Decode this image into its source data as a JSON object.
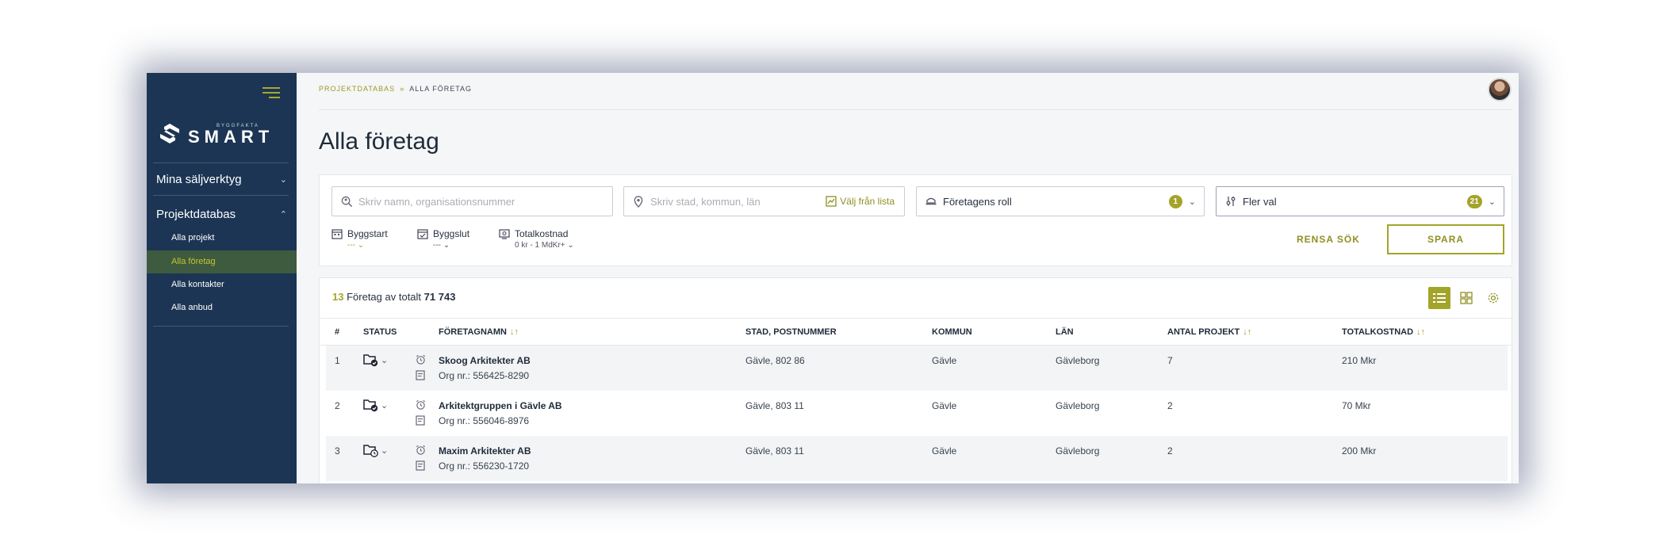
{
  "sidebar": {
    "logo_small": "BYGGFAKTA",
    "logo_big": "SMART",
    "sections": [
      {
        "label": "Mina säljverktyg",
        "expanded": false
      },
      {
        "label": "Projektdatabas",
        "expanded": true
      }
    ],
    "items": [
      {
        "label": "Alla projekt",
        "active": false
      },
      {
        "label": "Alla företag",
        "active": true
      },
      {
        "label": "Alla kontakter",
        "active": false
      },
      {
        "label": "Alla anbud",
        "active": false
      }
    ]
  },
  "breadcrumb": {
    "parent": "PROJEKTDATABAS",
    "separator": "»",
    "current": "ALLA FÖRETAG"
  },
  "page_title": "Alla företag",
  "filters": {
    "search_placeholder": "Skriv namn, organisationsnummer",
    "location_placeholder": "Skriv stad, kommun, län",
    "location_list_label": "Välj från lista",
    "role_label": "Företagens roll",
    "role_count": "1",
    "more_label": "Fler val",
    "more_count": "21",
    "byggstart_label": "Byggstart",
    "byggstart_value": "---",
    "byggslut_label": "Byggslut",
    "byggslut_value": "---",
    "totalkostnad_label": "Totalkostnad",
    "totalkostnad_value": "0 kr - 1 MdKr+",
    "clear_label": "RENSA SÖK",
    "save_label": "SPARA"
  },
  "results": {
    "count": "13",
    "count_text": "Företag av totalt",
    "total": "71 743"
  },
  "table": {
    "headers": {
      "num": "#",
      "status": "STATUS",
      "name": "FÖRETAGNAMN",
      "city": "STAD, POSTNUMMER",
      "kommun": "KOMMUN",
      "lan": "LÄN",
      "projects": "ANTAL PROJEKT",
      "cost": "TOTALKOSTNAD"
    },
    "rows": [
      {
        "num": "1",
        "name": "Skoog Arkitekter AB",
        "org": "Org nr.: 556425-8290",
        "city": "Gävle, 802 86",
        "kommun": "Gävle",
        "lan": "Gävleborg",
        "projects": "7",
        "cost": "210 Mkr"
      },
      {
        "num": "2",
        "name": "Arkitektgruppen i Gävle AB",
        "org": "Org nr.: 556046-8976",
        "city": "Gävle, 803 11",
        "kommun": "Gävle",
        "lan": "Gävleborg",
        "projects": "2",
        "cost": "70 Mkr"
      },
      {
        "num": "3",
        "name": "Maxim Arkitekter AB",
        "org": "Org nr.: 556230-1720",
        "city": "Gävle, 803 11",
        "kommun": "Gävle",
        "lan": "Gävleborg",
        "projects": "2",
        "cost": "200 Mkr"
      }
    ]
  },
  "colors": {
    "sidebar": "#1c3554",
    "accent": "#a3a42a",
    "active_nav_bg": "#3e5a3f"
  }
}
